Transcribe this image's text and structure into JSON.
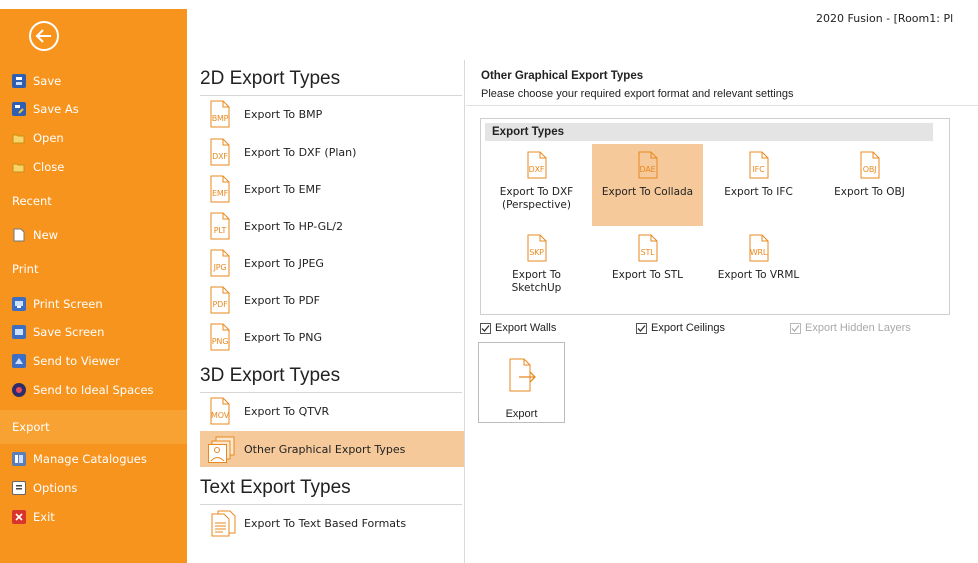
{
  "window": {
    "title": "2020 Fusion - [Room1: Pl"
  },
  "sidebar": {
    "items": [
      {
        "label": "Save",
        "icon": "save-icon"
      },
      {
        "label": "Save As",
        "icon": "save-as-icon"
      },
      {
        "label": "Open",
        "icon": "open-folder-icon"
      },
      {
        "label": "Close",
        "icon": "close-folder-icon"
      },
      {
        "label": "Recent"
      },
      {
        "label": "New",
        "icon": "new-document-icon"
      },
      {
        "label": "Print"
      },
      {
        "label": "Print Screen",
        "icon": "print-screen-icon"
      },
      {
        "label": "Save Screen",
        "icon": "save-screen-icon"
      },
      {
        "label": "Send to Viewer",
        "icon": "send-to-viewer-icon"
      },
      {
        "label": "Send to Ideal Spaces",
        "icon": "ideal-spaces-icon"
      },
      {
        "label": "Export",
        "active": true
      },
      {
        "label": "Manage Catalogues",
        "icon": "catalogues-icon"
      },
      {
        "label": "Options",
        "icon": "options-icon"
      },
      {
        "label": "Exit",
        "icon": "exit-icon"
      }
    ]
  },
  "middle": {
    "groups": [
      {
        "title": "2D Export Types"
      },
      {
        "title": "3D Export Types"
      },
      {
        "title": "Text Export Types"
      }
    ],
    "items": [
      {
        "label": "Export To BMP",
        "ext": "BMP"
      },
      {
        "label": "Export To DXF (Plan)",
        "ext": "DXF"
      },
      {
        "label": "Export To EMF",
        "ext": "EMF"
      },
      {
        "label": "Export To HP-GL/2",
        "ext": "PLT"
      },
      {
        "label": "Export To JPEG",
        "ext": "JPG"
      },
      {
        "label": "Export To PDF",
        "ext": "PDF"
      },
      {
        "label": "Export To PNG",
        "ext": "PNG"
      },
      {
        "label": "Export To QTVR",
        "ext": "MOV"
      },
      {
        "label": "Other Graphical Export Types",
        "selected": true
      },
      {
        "label": "Export To Text Based Formats"
      }
    ]
  },
  "panel": {
    "title": "Other Graphical Export Types",
    "subtitle": "Please choose your required export format and relevant settings",
    "types_header": "Export Types",
    "tiles": [
      {
        "label": "Export To DXF (Perspective)",
        "ext": "DXF"
      },
      {
        "label": "Export To Collada",
        "ext": "DAE",
        "selected": true
      },
      {
        "label": "Export To IFC",
        "ext": "IFC"
      },
      {
        "label": "Export To OBJ",
        "ext": "OBJ"
      },
      {
        "label": "Export To SketchUp",
        "ext": "SKP"
      },
      {
        "label": "Export To STL",
        "ext": "STL"
      },
      {
        "label": "Export To VRML",
        "ext": "WRL"
      }
    ],
    "options": [
      {
        "label": "Export Walls",
        "checked": true,
        "enabled": true
      },
      {
        "label": "Export Ceilings",
        "checked": true,
        "enabled": true
      },
      {
        "label": "Export Hidden Layers",
        "checked": true,
        "enabled": false
      }
    ],
    "export_button": "Export"
  },
  "colors": {
    "accent": "#f7941d",
    "selection": "#f6c99b",
    "icon": "#e8891f"
  }
}
